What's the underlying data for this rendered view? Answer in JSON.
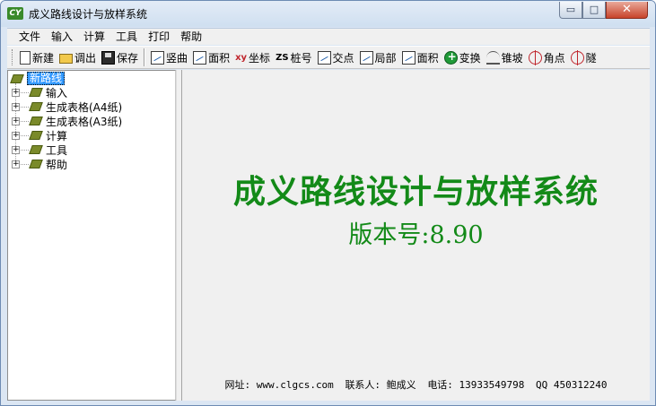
{
  "window": {
    "title": "成义路线设计与放样系统",
    "app_icon_text": "CY",
    "min_glyph": "▭",
    "max_glyph": "□",
    "close_glyph": "✕"
  },
  "menu": [
    "文件",
    "输入",
    "计算",
    "工具",
    "打印",
    "帮助"
  ],
  "toolbar": [
    {
      "icon": "new-file-icon",
      "label": "新建"
    },
    {
      "icon": "open-folder-icon",
      "label": "调出"
    },
    {
      "icon": "save-disk-icon",
      "label": "保存"
    },
    {
      "icon": "vertical-curve-icon",
      "label": "竖曲"
    },
    {
      "icon": "area-icon",
      "label": "面积"
    },
    {
      "icon": "xy-coordinate-icon",
      "icon_text": "xy",
      "label": "坐标"
    },
    {
      "icon": "zs-station-icon",
      "icon_text": "ZS",
      "label": "桩号"
    },
    {
      "icon": "intersection-icon",
      "label": "交点"
    },
    {
      "icon": "local-icon",
      "label": "局部"
    },
    {
      "icon": "area-2-icon",
      "label": "面积"
    },
    {
      "icon": "transform-globe-icon",
      "label": "变换"
    },
    {
      "icon": "cone-slope-icon",
      "label": "锥坡"
    },
    {
      "icon": "corner-point-icon",
      "label": "角点"
    },
    {
      "icon": "tunnel-icon",
      "label": "隧"
    }
  ],
  "tree": {
    "root": "新路线",
    "expander_glyph": "+",
    "nodes": [
      "输入",
      "生成表格(A4纸)",
      "生成表格(A3纸)",
      "计算",
      "工具",
      "帮助"
    ]
  },
  "main": {
    "title": "成义路线设计与放样系统",
    "version": "版本号:8.90",
    "footer": {
      "website": "网址: www.clgcs.com",
      "contact": "联系人: 鲍成义",
      "phone": "电话: 13933549798",
      "qq": "QQ 450312240"
    }
  },
  "colors": {
    "title_green": "#138a18",
    "selection_blue": "#3399ff",
    "close_red": "#c7432a"
  }
}
